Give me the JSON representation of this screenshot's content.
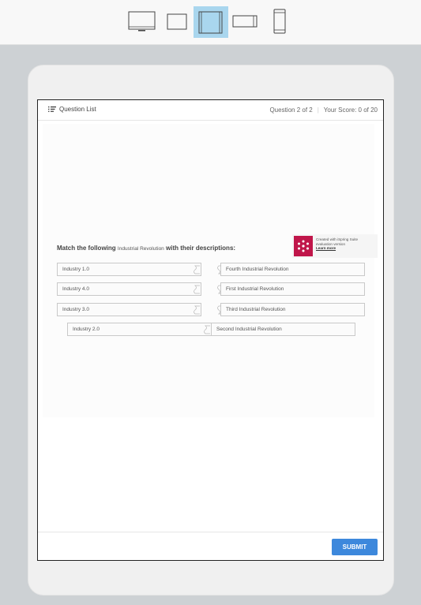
{
  "devices": [
    {
      "id": "desktop",
      "icon": "desktop-icon",
      "selected": false
    },
    {
      "id": "tablet-portrait",
      "icon": "tablet-portrait-icon",
      "selected": false
    },
    {
      "id": "tablet-landscape",
      "icon": "tablet-landscape-icon",
      "selected": true
    },
    {
      "id": "phone-landscape",
      "icon": "phone-landscape-icon",
      "selected": false
    },
    {
      "id": "phone-portrait",
      "icon": "phone-portrait-icon",
      "selected": false
    }
  ],
  "header": {
    "question_list": "Question List",
    "progress": "Question 2 of 2",
    "score": "Your Score: 0 of 20"
  },
  "question": {
    "prefix": "Match the following",
    "highlight": "Industrial Revolution",
    "suffix": "with their descriptions:"
  },
  "badge": {
    "line1": "Created with iSpring Suite",
    "line2": "evaluation version",
    "link": "Learn more"
  },
  "pairs": [
    {
      "left": "Industry 1.0",
      "right": "Fourth Industrial Revolution"
    },
    {
      "left": "Industry 4.0",
      "right": "First Industrial Revolution"
    },
    {
      "left": "Industry 3.0",
      "right": "Third Industrial Revolution"
    },
    {
      "left": "Industry 2.0",
      "right": "Second Industrial Revolution"
    }
  ],
  "footer": {
    "submit": "SUBMIT"
  },
  "colors": {
    "accent": "#3d88dc",
    "device_selected": "#a9d6ee",
    "brand": "#c0164a"
  }
}
